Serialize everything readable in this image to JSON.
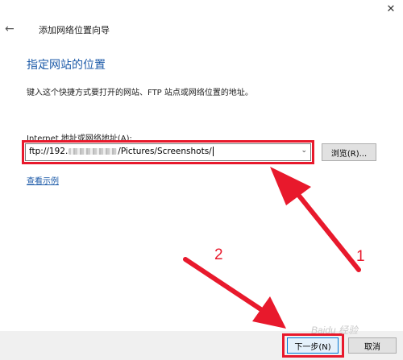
{
  "window": {
    "title": "添加网络位置向导",
    "close_glyph": "✕",
    "back_glyph": "←"
  },
  "page": {
    "heading": "指定网站的位置",
    "description": "键入这个快捷方式要打开的网站、FTP 站点或网络位置的地址。",
    "address_label": "Internet 地址或网络地址(A):",
    "address_value_prefix": "ftp://192.",
    "address_value_suffix": "/Pictures/Screenshots/",
    "dropdown_arrow": "⌄",
    "browse_label": "浏览(R)...",
    "example_link": "查看示例"
  },
  "footer": {
    "next_label": "下一步(N)",
    "cancel_label": "取消"
  },
  "annotations": {
    "label_1": "1",
    "label_2": "2",
    "watermark": "Baidu 经验",
    "color": "#e8192c"
  }
}
